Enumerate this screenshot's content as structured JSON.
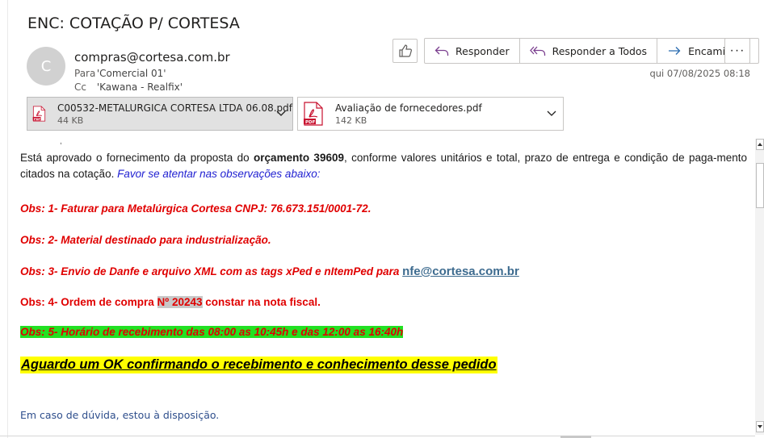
{
  "email": {
    "subject": "ENC: COTAÇÃO P/ CORTESA",
    "avatar_initial": "C",
    "from": "compras@cortesa.com.br",
    "to_label": "Para",
    "to": "'Comercial 01'",
    "cc_label": "Cc",
    "cc": "'Kawana - Realfix'",
    "date": "qui 07/08/2025 08:18"
  },
  "toolbar": {
    "reply": "Responder",
    "reply_all": "Responder a Todos",
    "forward": "Encaminhar",
    "more": "···"
  },
  "attachments": [
    {
      "name": "C00532-METALURGICA CORTESA LTDA 06.08.pdf",
      "size": "44 KB",
      "icon": "pdf-icon"
    },
    {
      "name": "Avaliação de fornecedores.pdf",
      "size": "142 KB",
      "icon": "pdf-icon"
    }
  ],
  "body": {
    "fragment_top": ",",
    "intro_pre": "Está aprovado o fornecimento da proposta do ",
    "intro_bold": "orçamento 39609",
    "intro_post": ", conforme valores unitários e total, prazo de entrega e condição de paga-mento citados na cotação. ",
    "intro_note": "Favor se atentar nas observações abaixo:",
    "obs1": "Obs: 1- Faturar para Metalúrgica Cortesa CNPJ: 76.673.151/0001-72.",
    "obs2": "Obs: 2- Material destinado para industrialização.",
    "obs3_pre": "Obs: 3- Envio de Danfe e arquivo XML com as tags xPed e nItemPed para ",
    "obs3_link": "nfe@cortesa.com.br",
    "obs4_pre": "Obs: 4- Ordem de compra ",
    "obs4_highlight": "Nº 20243",
    "obs4_post": " constar na nota fiscal.",
    "obs5": "Obs: 5- Horário de recebimento das 08:00 as 10:45h e das 12:00 as 16:40h",
    "final": "Aguardo um OK confirmando o recebimento e conhecimento desse pedido",
    "footer": "Em caso de dúvida, estou à disposição."
  },
  "colors": {
    "obs_red": "#e00000",
    "highlight_green": "#22e122",
    "highlight_yellow": "#ffff00",
    "link_blue": "#3d6b8f",
    "pdf_red": "#c8102e"
  }
}
